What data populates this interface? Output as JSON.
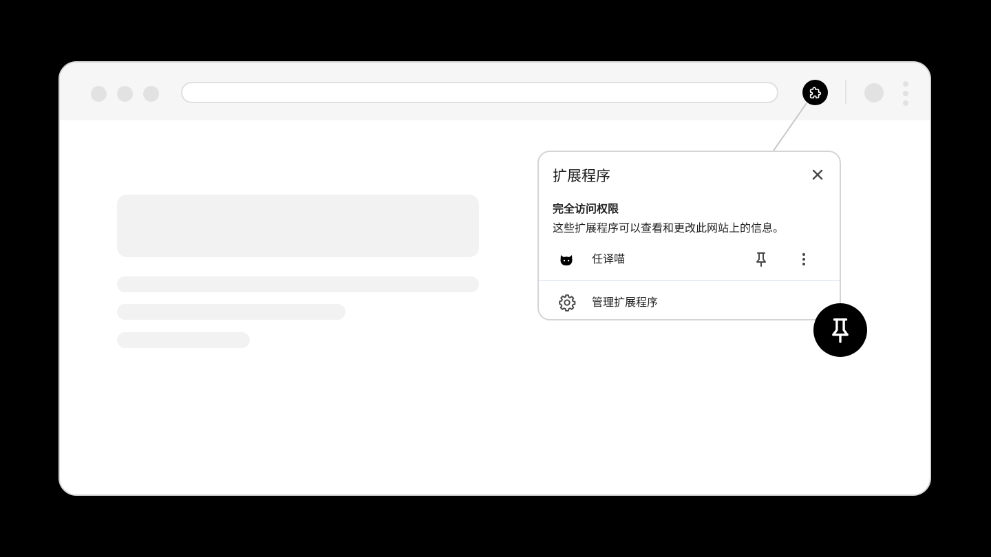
{
  "popup": {
    "title": "扩展程序",
    "section_heading": "完全访问权限",
    "section_description": "这些扩展程序可以查看和更改此网站上的信息。",
    "extension": {
      "name": "任译喵",
      "icon": "cat-icon"
    },
    "manage_label": "管理扩展程序"
  },
  "icons": {
    "toolbar_extensions": "puzzle-icon",
    "close": "close-icon",
    "pin": "pin-icon",
    "more": "more-vert-icon",
    "manage": "gear-icon",
    "callout": "pin-icon"
  },
  "colors": {
    "backdrop": "#000000",
    "browser_frame": "#ffffff",
    "toolbar": "#f6f6f6",
    "placeholder": "#f2f2f2",
    "accent": "#000000"
  }
}
